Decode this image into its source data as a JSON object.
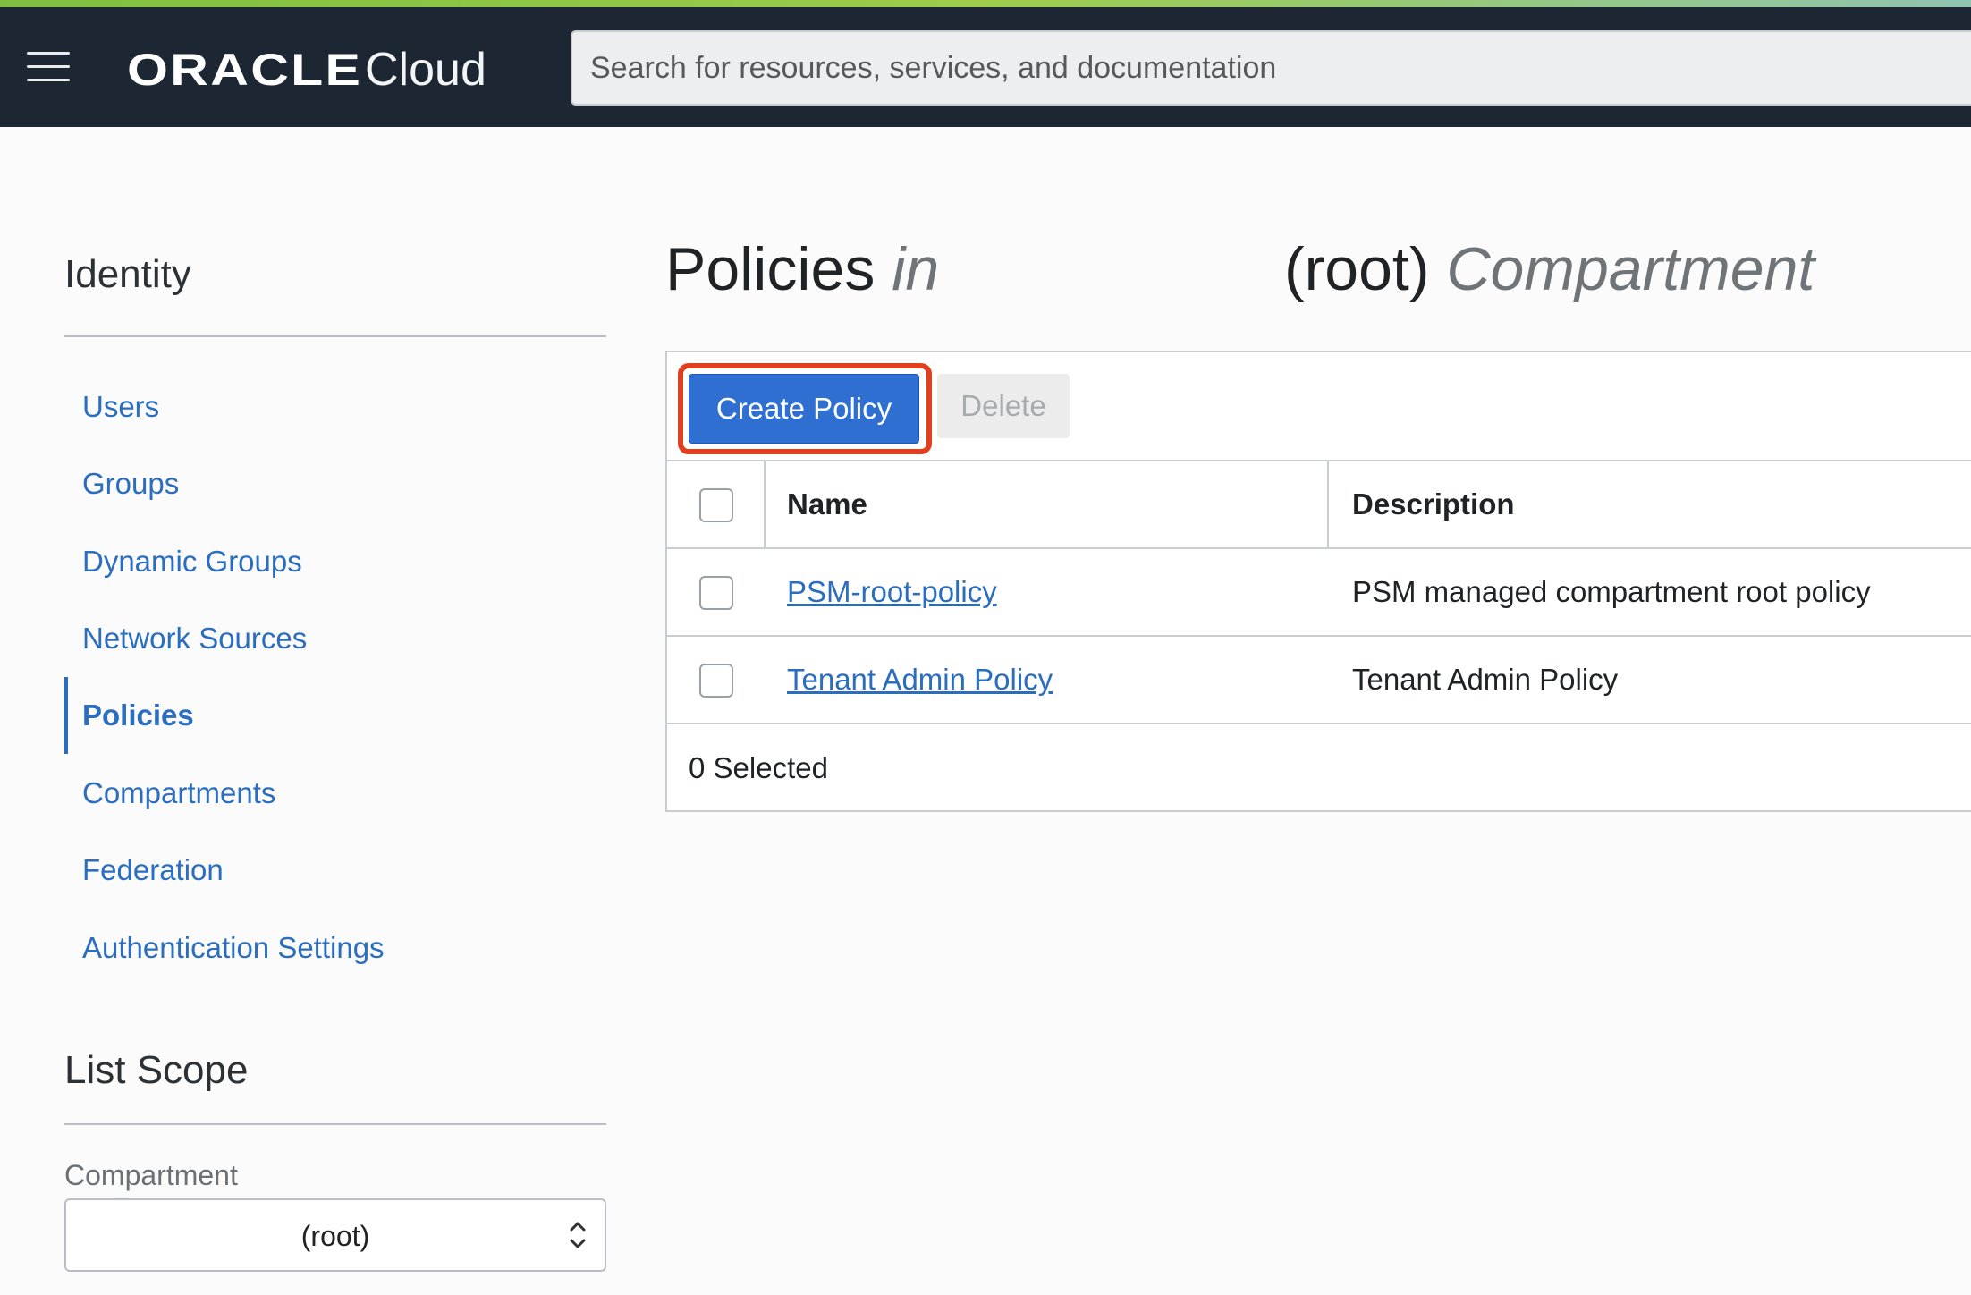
{
  "header": {
    "brand": "ORACLE",
    "product": "Cloud",
    "search_placeholder": "Search for resources, services, and documentation"
  },
  "sidebar": {
    "title": "Identity",
    "items": [
      {
        "label": "Users"
      },
      {
        "label": "Groups"
      },
      {
        "label": "Dynamic Groups"
      },
      {
        "label": "Network Sources"
      },
      {
        "label": "Policies",
        "active": true
      },
      {
        "label": "Compartments"
      },
      {
        "label": "Federation"
      },
      {
        "label": "Authentication Settings"
      }
    ],
    "scope_title": "List Scope",
    "compartment_label": "Compartment",
    "compartment_value": "(root)"
  },
  "main": {
    "title_word": "Policies",
    "title_in": "in",
    "title_root": "(root)",
    "title_compartment": "Compartment",
    "toolbar": {
      "create_label": "Create Policy",
      "delete_label": "Delete"
    },
    "columns": [
      "Name",
      "Description"
    ],
    "rows": [
      {
        "name": "PSM-root-policy",
        "description": "PSM managed compartment root policy"
      },
      {
        "name": "Tenant Admin Policy",
        "description": "Tenant Admin Policy"
      }
    ],
    "selected_status": "0 Selected"
  },
  "colors": {
    "header_bg": "#1d2733",
    "link": "#2b6dbf",
    "primary_button": "#2e6fd1",
    "highlight": "#e04020"
  }
}
